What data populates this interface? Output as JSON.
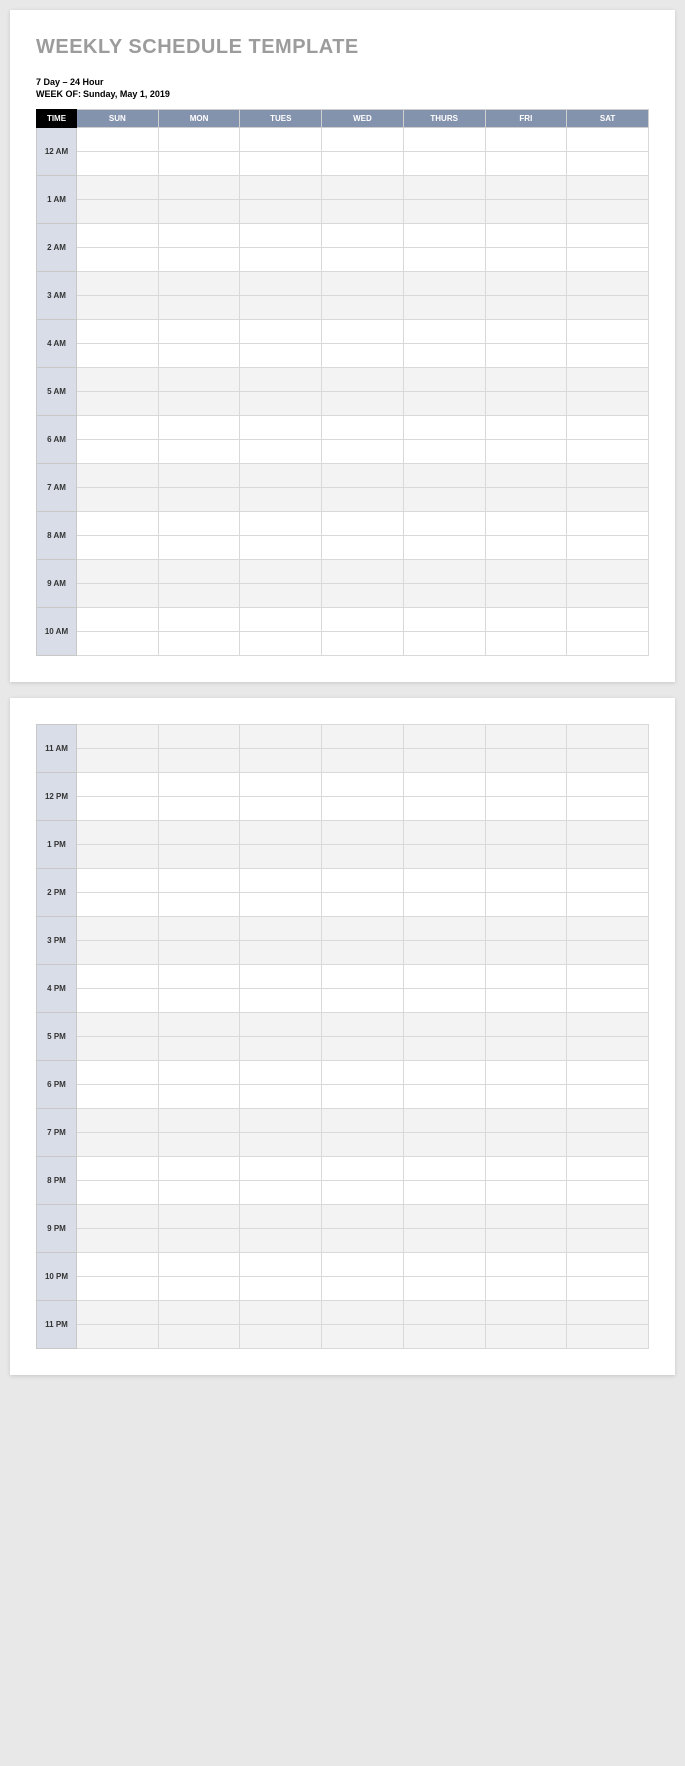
{
  "title": "WEEKLY SCHEDULE TEMPLATE",
  "subtitle1": "7 Day – 24 Hour",
  "week_of_label": "WEEK OF:",
  "week_of_value": "Sunday, May 1, 2019",
  "headers": {
    "time": "TIME",
    "days": [
      "SUN",
      "MON",
      "TUES",
      "WED",
      "THURS",
      "FRI",
      "SAT"
    ]
  },
  "page1_hours": [
    "12 AM",
    "1 AM",
    "2 AM",
    "3 AM",
    "4 AM",
    "5 AM",
    "6 AM",
    "7 AM",
    "8 AM",
    "9 AM",
    "10 AM"
  ],
  "page2_hours": [
    "11 AM",
    "12 PM",
    "1 PM",
    "2 PM",
    "3 PM",
    "4 PM",
    "5 PM",
    "6 PM",
    "7 PM",
    "8 PM",
    "9 PM",
    "10 PM",
    "11 PM"
  ],
  "page1_shading": [
    "even",
    "odd",
    "even",
    "odd",
    "even",
    "odd",
    "even",
    "odd",
    "even",
    "odd",
    "even"
  ],
  "page2_shading": [
    "odd",
    "even",
    "odd",
    "even",
    "odd",
    "even",
    "odd",
    "even",
    "odd",
    "even",
    "odd",
    "even",
    "odd"
  ]
}
